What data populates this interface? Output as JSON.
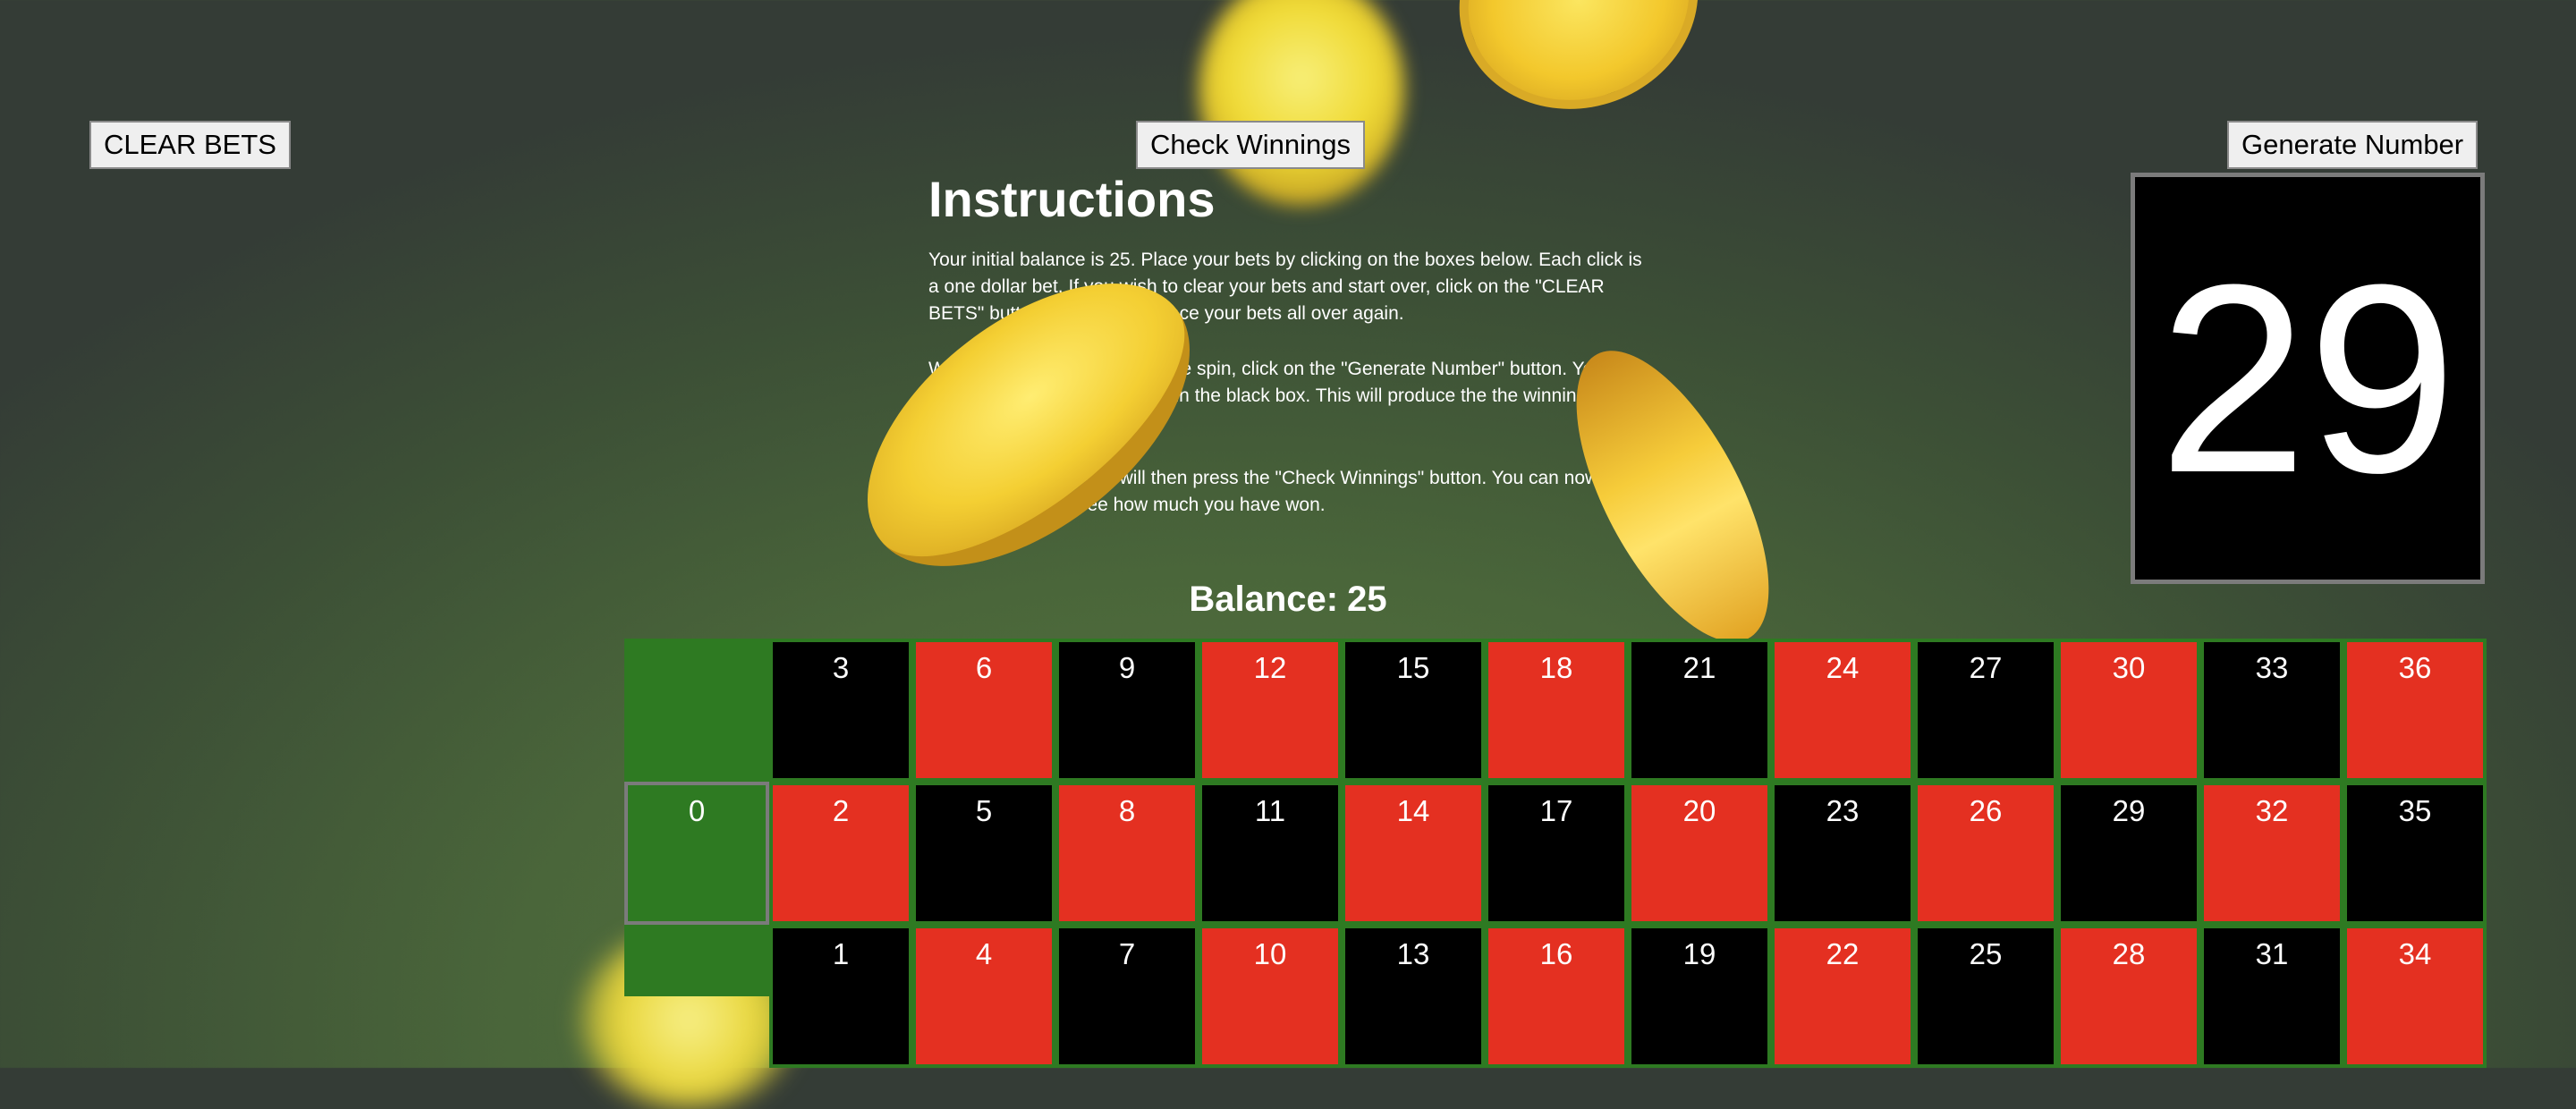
{
  "buttons": {
    "clear_bets": "CLEAR BETS",
    "check_winnings": "Check Winnings",
    "generate_number": "Generate Number"
  },
  "instructions": {
    "title": "Instructions",
    "paragraphs": [
      "Your initial balance is 25. Place your bets by clicking on the boxes below. Each click is a one dollar bet. If you wish to clear your bets and start over, click on the \"CLEAR BETS\" button and you can place your bets all over again.",
      "When you are ready to start the spin, click on the \"Generate Number\" button. You will then see the winning number in the black box. This will produce the the winning number.",
      "To see if you won, you will then press the \"Check Winnings\" button. You can now check your balance and see how much you have won."
    ]
  },
  "winning_number": "29",
  "balance": {
    "label": "Balance:",
    "value": "25"
  },
  "board": {
    "zero": "0",
    "rows": [
      [
        {
          "n": "3",
          "c": "black"
        },
        {
          "n": "6",
          "c": "red"
        },
        {
          "n": "9",
          "c": "black"
        },
        {
          "n": "12",
          "c": "red"
        },
        {
          "n": "15",
          "c": "black"
        },
        {
          "n": "18",
          "c": "red"
        },
        {
          "n": "21",
          "c": "black"
        },
        {
          "n": "24",
          "c": "red"
        },
        {
          "n": "27",
          "c": "black"
        },
        {
          "n": "30",
          "c": "red"
        },
        {
          "n": "33",
          "c": "black"
        },
        {
          "n": "36",
          "c": "red"
        }
      ],
      [
        {
          "n": "2",
          "c": "red"
        },
        {
          "n": "5",
          "c": "black"
        },
        {
          "n": "8",
          "c": "red"
        },
        {
          "n": "11",
          "c": "black"
        },
        {
          "n": "14",
          "c": "red"
        },
        {
          "n": "17",
          "c": "black"
        },
        {
          "n": "20",
          "c": "red"
        },
        {
          "n": "23",
          "c": "black"
        },
        {
          "n": "26",
          "c": "red"
        },
        {
          "n": "29",
          "c": "black"
        },
        {
          "n": "32",
          "c": "red"
        },
        {
          "n": "35",
          "c": "black"
        }
      ],
      [
        {
          "n": "1",
          "c": "black"
        },
        {
          "n": "4",
          "c": "red"
        },
        {
          "n": "7",
          "c": "black"
        },
        {
          "n": "10",
          "c": "red"
        },
        {
          "n": "13",
          "c": "black"
        },
        {
          "n": "16",
          "c": "red"
        },
        {
          "n": "19",
          "c": "black"
        },
        {
          "n": "22",
          "c": "red"
        },
        {
          "n": "25",
          "c": "black"
        },
        {
          "n": "28",
          "c": "red"
        },
        {
          "n": "31",
          "c": "black"
        },
        {
          "n": "34",
          "c": "red"
        }
      ]
    ]
  },
  "colors": {
    "red": "#e43021",
    "black": "#000000",
    "green": "#2e7a22"
  }
}
